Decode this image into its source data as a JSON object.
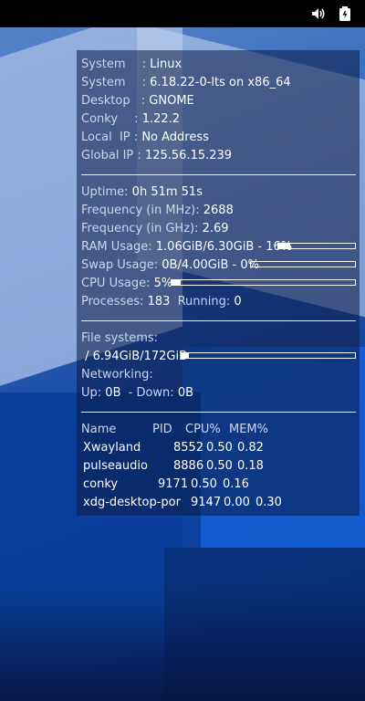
{
  "topbar": {
    "volume_icon": "volume-icon",
    "battery_icon": "battery-icon"
  },
  "system": [
    {
      "label": "System",
      "sep": ":",
      "value": "Linux"
    },
    {
      "label": "System",
      "sep": ":",
      "value": "6.18.22-0-lts on x86_64"
    },
    {
      "label": "Desktop",
      "sep": ":",
      "value": "GNOME"
    },
    {
      "label": "Conky",
      "sep": ":",
      "value": "1.22.2"
    },
    {
      "label": "Local  IP",
      "sep": ":",
      "value": "No Address"
    },
    {
      "label": "Global IP",
      "sep": ":",
      "value": "125.56.15.239"
    }
  ],
  "stats": {
    "uptime_label": "Uptime:",
    "uptime_value": "0h 51m 51s",
    "freq_mhz_label": "Frequency (in MHz):",
    "freq_mhz_value": "2688",
    "freq_ghz_label": "Frequency (in GHz):",
    "freq_ghz_value": "2.69",
    "ram_label": "RAM Usage:",
    "ram_value": "1.06GiB/6.30GiB - 16%",
    "ram_fraction": 0.16,
    "swap_label": "Swap Usage:",
    "swap_value": "0B/4.00GiB - 0%",
    "swap_fraction": 0.0,
    "cpu_label": "CPU Usage:",
    "cpu_value": "5%",
    "cpu_fraction": 0.05,
    "processes_label": "Processes:",
    "processes_value": "183",
    "running_label": "Running:",
    "running_value": "0"
  },
  "filesystems": {
    "label": "File systems:",
    "root_value": " / 6.94GiB/172GiB",
    "root_fraction": 0.04,
    "networking_label": "Networking:",
    "up_label": "Up:",
    "up_value": "0B",
    "down_label": "- Down:",
    "down_value": "0B"
  },
  "processes": {
    "headers": [
      "Name",
      "PID",
      "CPU%",
      "MEM%"
    ],
    "rows": [
      [
        "Xwayland",
        "8552",
        "0.50",
        "0.82"
      ],
      [
        "pulseaudio",
        "8886",
        "0.50",
        "0.18"
      ],
      [
        "conky",
        "9171",
        "0.50",
        "0.16"
      ],
      [
        "xdg-desktop-por",
        "9147",
        "0.00",
        "0.30"
      ]
    ]
  }
}
